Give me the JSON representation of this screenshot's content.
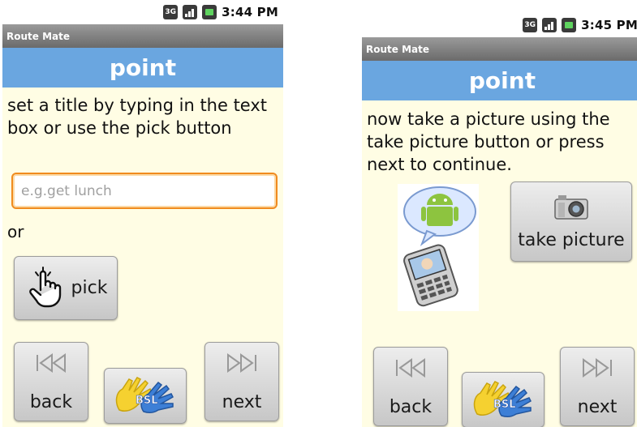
{
  "left": {
    "status_bar": {
      "network_icon": "3G",
      "time": "3:44 PM"
    },
    "app_title": "Route Mate",
    "header": "point",
    "instruction": "set a title by typing in the text box or use the pick button",
    "title_input": {
      "value": "",
      "placeholder": "e.g.get lunch"
    },
    "or_label": "or",
    "pick_button": {
      "label": "pick",
      "icon": "hand-pointer-icon"
    },
    "back_button": {
      "label": "back",
      "icon": "skip-back-icon"
    },
    "bsl_button": {
      "icon_text": "BSL",
      "icon": "bsl-hands-icon"
    },
    "next_button": {
      "label": "next",
      "icon": "skip-forward-icon"
    }
  },
  "right": {
    "status_bar": {
      "network_icon": "3G",
      "time": "3:45 PM"
    },
    "app_title": "Route Mate",
    "header": "point",
    "instruction": "now take a picture using the take picture button or press next to continue.",
    "take_picture_button": {
      "label": "take picture",
      "icon": "camera-icon"
    },
    "photo": {
      "icon": "android-phone-illustration"
    },
    "back_button": {
      "label": "back",
      "icon": "skip-back-icon"
    },
    "bsl_button": {
      "icon_text": "BSL",
      "icon": "bsl-hands-icon"
    },
    "next_button": {
      "label": "next",
      "icon": "skip-forward-icon"
    }
  },
  "colors": {
    "header_blue": "#6aa6e0",
    "background_cream": "#fffde4",
    "input_focus_orange": "#f08b1f",
    "titlebar_gray": "#7f7f7f"
  }
}
